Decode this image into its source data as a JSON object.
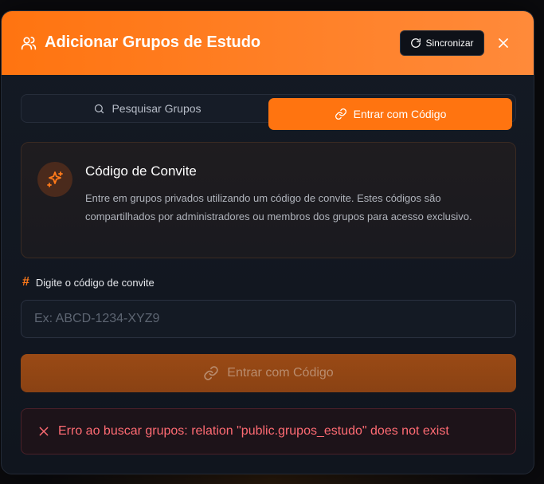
{
  "header": {
    "title": "Adicionar Grupos de Estudo",
    "sync_label": "Sincronizar"
  },
  "tabs": [
    {
      "label": "Pesquisar Grupos",
      "active": false
    },
    {
      "label": "Entrar com Código",
      "active": true
    }
  ],
  "info": {
    "title": "Código de Convite",
    "description": "Entre em grupos privados utilizando um código de convite. Estes códigos são compartilhados por administradores ou membros dos grupos para acesso exclusivo."
  },
  "form": {
    "label": "Digite o código de convite",
    "placeholder": "Ex: ABCD-1234-XYZ9",
    "value": "",
    "submit_label": "Entrar com Código"
  },
  "error": {
    "message": "Erro ao buscar grupos: relation \"public.grupos_estudo\" does not exist"
  },
  "colors": {
    "accent": "#ff7410",
    "error": "#ff6b73"
  },
  "icons": [
    "users-icon",
    "refresh-icon",
    "close-icon",
    "search-icon",
    "link-icon",
    "sparkles-icon",
    "hash-icon",
    "x-icon"
  ]
}
